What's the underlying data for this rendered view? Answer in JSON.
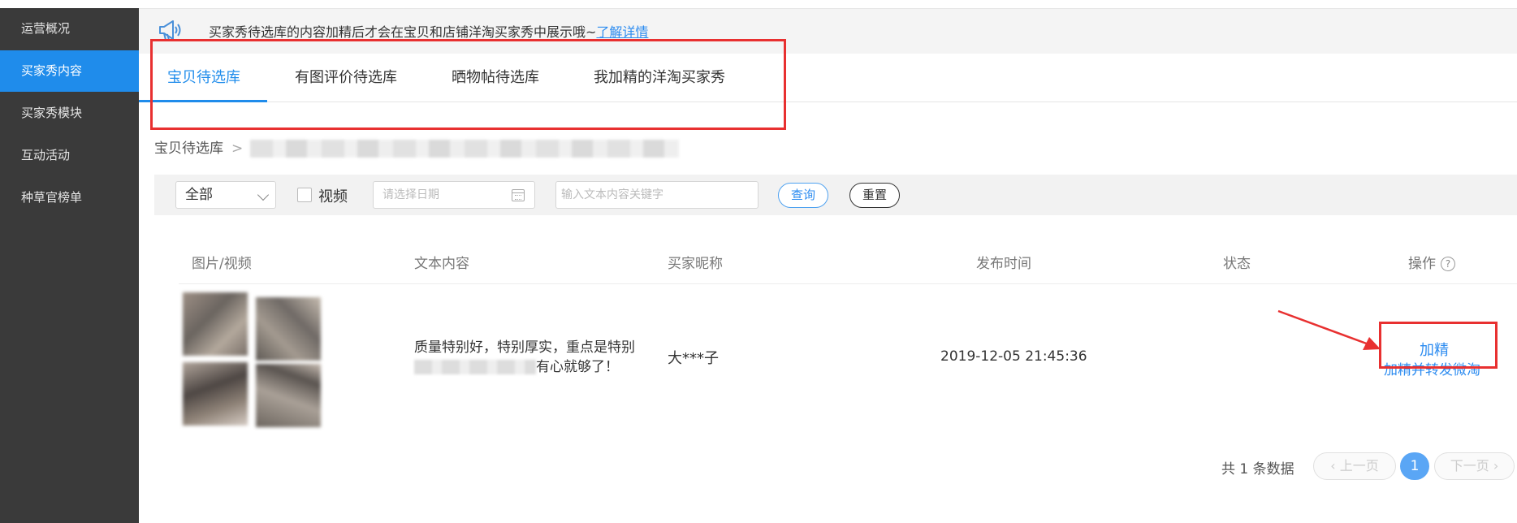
{
  "sidebar": {
    "items": [
      {
        "label": "运营概况",
        "active": false
      },
      {
        "label": "买家秀内容",
        "active": true
      },
      {
        "label": "买家秀模块",
        "active": false
      },
      {
        "label": "互动活动",
        "active": false
      },
      {
        "label": "种草官榜单",
        "active": false
      }
    ]
  },
  "notice": {
    "icon": "megaphone-icon",
    "text": "买家秀待选库的内容加精后才会在宝贝和店铺洋淘买家秀中展示哦~",
    "link": "了解详情"
  },
  "tabs": [
    {
      "label": "宝贝待选库",
      "active": true
    },
    {
      "label": "有图评价待选库",
      "active": false
    },
    {
      "label": "晒物帖待选库",
      "active": false
    },
    {
      "label": "我加精的洋淘买家秀",
      "active": false
    }
  ],
  "breadcrumb": {
    "root": "宝贝待选库",
    "separator": ">"
  },
  "filters": {
    "select_value": "全部",
    "video_label": "视频",
    "date_placeholder": "请选择日期",
    "keyword_placeholder": "输入文本内容关键字",
    "query_button": "查询",
    "reset_button": "重置"
  },
  "table": {
    "headers": [
      "图片/视频",
      "文本内容",
      "买家昵称",
      "发布时间",
      "状态",
      "操作"
    ],
    "help_icon": "?",
    "rows": [
      {
        "text_line1": "质量特别好，特别厚实，重点是特别",
        "text_line2_tail": "有心就够了！",
        "nickname": "大***子",
        "time": "2019-12-05 21:45:36",
        "status": "",
        "actions": [
          "加精",
          "加精并转发微淘"
        ]
      }
    ]
  },
  "pagination": {
    "total": "共 1 条数据",
    "prev": "‹ 上一页",
    "current": "1",
    "next": "下一页 ›"
  },
  "colors": {
    "accent": "#1f8ceb",
    "sidebar_bg": "#3a3a3a",
    "annotation_red": "#e83030"
  }
}
